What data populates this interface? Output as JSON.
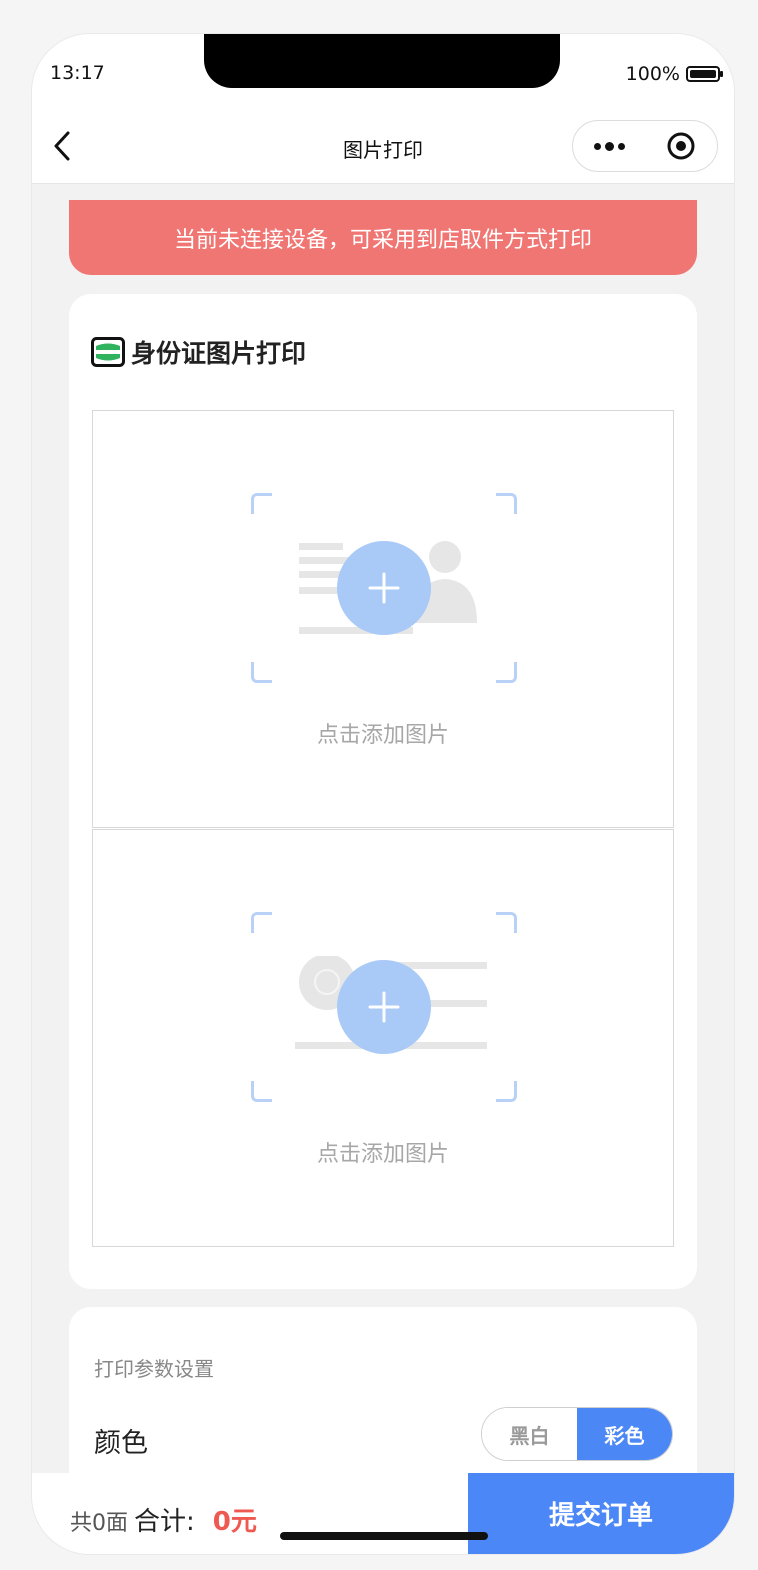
{
  "status_bar": {
    "time": "13:17",
    "battery": "100%"
  },
  "nav": {
    "title": "图片打印"
  },
  "alert": {
    "text": "当前未连接设备，可采用到店取件方式打印"
  },
  "id_card": {
    "title": "身份证图片打印",
    "uploads": [
      {
        "hint": "点击添加图片",
        "side": "portrait"
      },
      {
        "hint": "点击添加图片",
        "side": "emblem"
      }
    ]
  },
  "settings": {
    "title": "打印参数设置",
    "color_label": "颜色",
    "options": [
      "黑白",
      "彩色"
    ],
    "selected": "彩色"
  },
  "bottom_bar": {
    "count": "共0面",
    "total_label": "合计:",
    "price": "0元",
    "submit_label": "提交订单"
  },
  "colors": {
    "alert_bg": "#f07673",
    "accent": "#4c87f7",
    "price": "#ee5a52",
    "plus_circle": "#a9c9f7"
  }
}
